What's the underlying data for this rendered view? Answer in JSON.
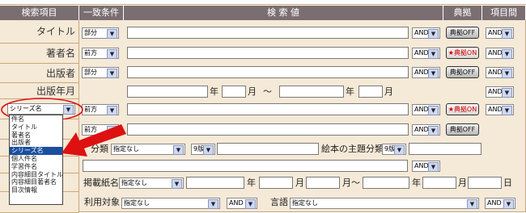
{
  "headers": {
    "field": "検索項目",
    "match": "一致条件",
    "value": "検 索 値",
    "typo": "典拠",
    "between": "項目間"
  },
  "rows": {
    "title": {
      "label": "タイトル",
      "match": "部分",
      "op": "AND",
      "typo": "典拠OFF",
      "between": "AND"
    },
    "author": {
      "label": "著者名",
      "match": "前方",
      "op": "AND",
      "typo": "★典拠ON",
      "between": "AND"
    },
    "publisher": {
      "label": "出版者",
      "match": "部分",
      "op": "AND",
      "typo": "典拠OFF",
      "between": "AND"
    },
    "pubdate": {
      "label": "出版年月",
      "year": "年",
      "month": "月",
      "tilde": "〜",
      "between": "AND"
    },
    "series": {
      "label": "シリーズ名",
      "match": "前方",
      "op": "AND",
      "typo": "★典拠ON",
      "between": "AND"
    },
    "row6": {
      "match": "前方",
      "op": "AND",
      "typo": "典拠OFF"
    }
  },
  "classify": {
    "label_suffix": "分類",
    "sel1": "指定なし",
    "sel2": "9版",
    "picture_label": "絵本の主題分類",
    "sel3": "9版"
  },
  "row8": {
    "op": "AND"
  },
  "magazine": {
    "label": "掲載紙名",
    "sel": "指定なし",
    "year": "年",
    "month": "月",
    "tilde": "月〜",
    "year2": "年",
    "month2": "月",
    "day": "日"
  },
  "bottom": {
    "target_label": "利用対象",
    "target_sel": "指定なし",
    "op": "AND",
    "lang_label": "言語",
    "lang_sel": "指定なし",
    "op2": "AND"
  },
  "dropdown": {
    "items": [
      "件名",
      "タイトル",
      "著者名",
      "出版者",
      "シリーズ名",
      "個人件名",
      "学習件名",
      "内容細目タイトル",
      "内容細目著者名",
      "目次情報"
    ],
    "selected_index": 4
  },
  "colors": {
    "header": "#7a6e73",
    "row_bg": "#f5e9d7",
    "highlight": "#1a4fa0",
    "annotation": "#dd1111"
  }
}
